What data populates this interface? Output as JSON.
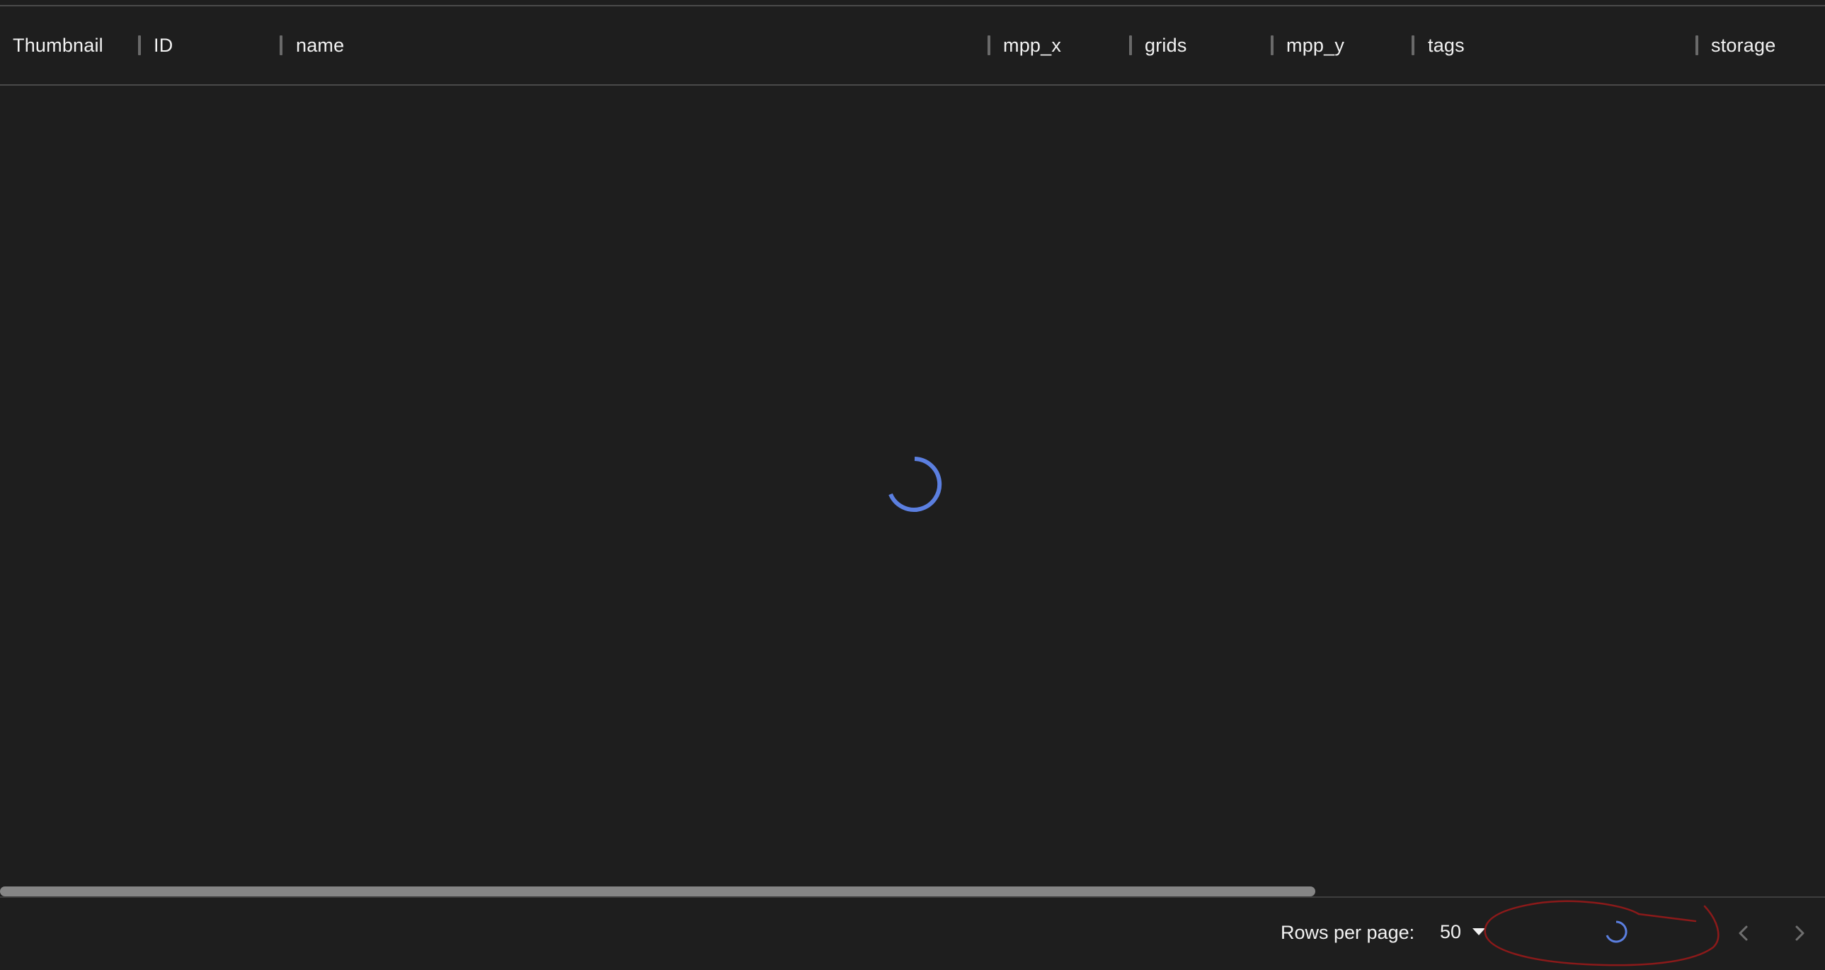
{
  "table": {
    "columns": [
      {
        "key": "thumbnail",
        "label": "Thumbnail"
      },
      {
        "key": "id",
        "label": "ID"
      },
      {
        "key": "name",
        "label": "name"
      },
      {
        "key": "mpp_x",
        "label": "mpp_x"
      },
      {
        "key": "grids",
        "label": "grids"
      },
      {
        "key": "mpp_y",
        "label": "mpp_y"
      },
      {
        "key": "tags",
        "label": "tags"
      },
      {
        "key": "storage",
        "label": "storage"
      }
    ],
    "loading": true
  },
  "pagination": {
    "rows_per_page_label": "Rows per page:",
    "rows_per_page_value": "50",
    "prev_icon": "chevron-left-icon",
    "next_icon": "chevron-right-icon"
  },
  "colors": {
    "background": "#1e1e1e",
    "spinner": "#5b7fe0",
    "annotation": "#8b1a1a",
    "text": "#f2f2f2"
  }
}
